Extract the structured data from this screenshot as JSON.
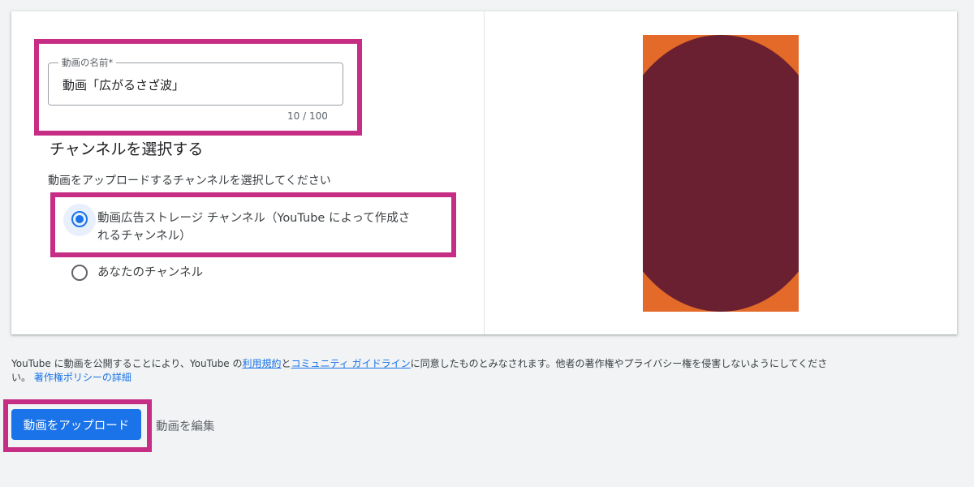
{
  "form": {
    "video_name_label": "動画の名前*",
    "video_name_value": "動画「広がるさざ波」",
    "char_counter": "10 / 100"
  },
  "channel": {
    "heading": "チャンネルを選択する",
    "instruction": "動画をアップロードするチャンネルを選択してください",
    "options": [
      {
        "label_line1": "動画広告ストレージ チャンネル（YouTube によって作成さ",
        "label_line2": "れるチャンネル）",
        "selected": true
      },
      {
        "label_line1": "あなたのチャンネル",
        "selected": false
      }
    ]
  },
  "terms": {
    "text_before": "YouTube に動画を公開することにより、YouTube の",
    "link_terms": "利用規約",
    "text_and": "と",
    "link_guidelines": "コミュニティ ガイドライン",
    "text_after": "に同意したものとみなされます。他者の著作権やプライバシー権を侵害しないようにしてくださ",
    "text_line2": "い。",
    "link_copyright": "著作権ポリシーの詳細"
  },
  "actions": {
    "upload_label": "動画をアップロード",
    "edit_label": "動画を編集"
  },
  "colors": {
    "highlight": "#c62d85",
    "accent": "#1a73e8",
    "preview_orange": "#e36a28",
    "preview_maroon": "#6a2031"
  }
}
